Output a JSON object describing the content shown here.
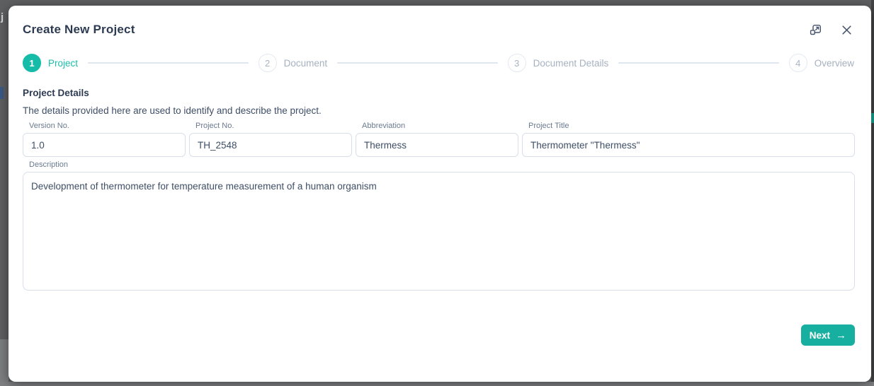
{
  "backdrop": {
    "clipped_text_left": "j"
  },
  "modal": {
    "title": "Create New Project",
    "header_icons": {
      "expand": "expand-icon",
      "close": "close-icon"
    }
  },
  "stepper": {
    "steps": [
      {
        "number": "1",
        "label": "Project",
        "active": true
      },
      {
        "number": "2",
        "label": "Document",
        "active": false
      },
      {
        "number": "3",
        "label": "Document Details",
        "active": false
      },
      {
        "number": "4",
        "label": "Overview",
        "active": false
      }
    ]
  },
  "form": {
    "section_title": "Project Details",
    "section_subtitle": "The details provided here are used to identify and describe the project.",
    "fields": [
      {
        "label": "Version No.",
        "value": "1.0"
      },
      {
        "label": "Project No.",
        "value": "TH_2548"
      },
      {
        "label": "Abbreviation",
        "value": "Thermess"
      },
      {
        "label": "Project Title",
        "value": "Thermometer \"Thermess\""
      }
    ],
    "description_field": {
      "label": "Description",
      "value": "Development of thermometer for temperature measurement of a human organism"
    }
  },
  "footer": {
    "next_label": "Next",
    "next_arrow": "→"
  },
  "colors": {
    "accent_teal": "#16bca8",
    "button_teal": "#17b0a0",
    "title_text": "#2d3b52",
    "muted_step_text": "#a6b1c0",
    "field_label_text": "#6b7a90",
    "input_border": "#d9dfe9",
    "backdrop_gray": "#5e5f61"
  }
}
